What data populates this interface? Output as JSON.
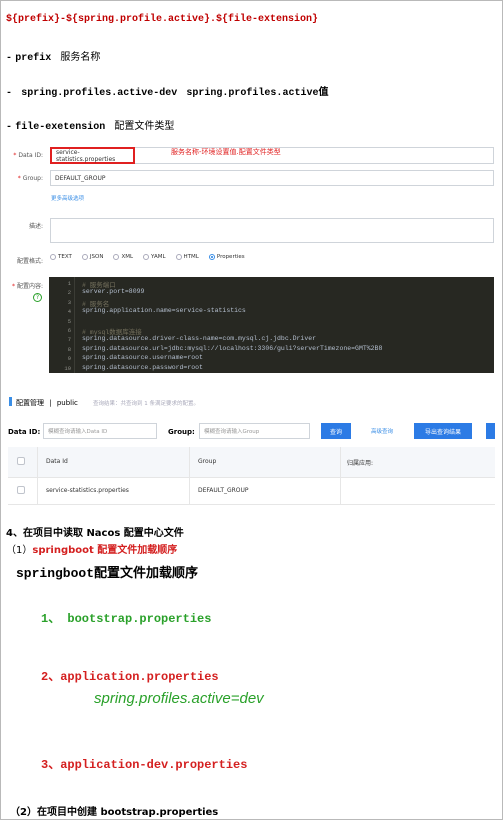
{
  "doc": {
    "heading": "${prefix}-${spring.profile.active}.${file-extension}",
    "bullets": [
      {
        "dash": "-",
        "key": "prefix",
        "desc": "服务名称"
      },
      {
        "dash": "-",
        "key": "spring.profiles.active-dev",
        "desc": "spring.profiles.active值"
      },
      {
        "dash": "-",
        "key": "file-exetension",
        "desc": "配置文件类型"
      }
    ]
  },
  "form": {
    "data_id_label": "Data ID:",
    "data_id_value": "service-statistics.properties",
    "annotation": "服务名称-环境设置值.配置文件类型",
    "group_label": "Group:",
    "group_value": "DEFAULT_GROUP",
    "advanced_link": "更多高级选项",
    "desc_label": "描述:",
    "format_label": "配置格式:",
    "formats": [
      "TEXT",
      "JSON",
      "XML",
      "YAML",
      "HTML",
      "Properties"
    ],
    "format_selected": "Properties",
    "content_label": "配置内容:",
    "help_icon": "?",
    "code_lines": [
      {
        "n": "1",
        "type": "comment",
        "text": "# 服务端口"
      },
      {
        "n": "2",
        "type": "key",
        "text": "server.port=8099"
      },
      {
        "n": "3",
        "type": "comment",
        "text": "# 服务名"
      },
      {
        "n": "4",
        "type": "key",
        "text": "spring.application.name=service-statistics"
      },
      {
        "n": "5",
        "type": "key",
        "text": ""
      },
      {
        "n": "6",
        "type": "comment",
        "text": "# mysql数据库连接"
      },
      {
        "n": "7",
        "type": "key",
        "text": "spring.datasource.driver-class-name=com.mysql.cj.jdbc.Driver"
      },
      {
        "n": "8",
        "type": "key",
        "text": "spring.datasource.url=jdbc:mysql://localhost:3306/guli?serverTimezone=GMT%2B8"
      },
      {
        "n": "9",
        "type": "key",
        "text": "spring.datasource.username=root"
      },
      {
        "n": "10",
        "type": "key",
        "text": "spring.datasource.password=root"
      }
    ]
  },
  "config_list": {
    "title": "配置管理",
    "separator": "|",
    "namespace": "public",
    "result_text": "查询结果：共查询到 1 条满足要求的配置。",
    "data_id_label": "Data ID:",
    "data_id_placeholder": "模糊查询请输入Data ID",
    "group_label": "Group:",
    "group_placeholder": "模糊查询请输入Group",
    "query_button": "查询",
    "advanced_query": "高级查询",
    "export_button": "导出查询结果",
    "columns": [
      "Data Id",
      "Group",
      "归属应用:"
    ],
    "rows": [
      {
        "data_id": "service-statistics.properties",
        "group": "DEFAULT_GROUP",
        "app": ""
      }
    ]
  },
  "section": {
    "heading": "4、在项目中读取 Nacos 配置中心文件",
    "sub1_prefix": "（1）",
    "sub1_text": "springboot 配置文件加载顺序",
    "order_title": "springboot配置文件加载顺序",
    "items": [
      {
        "text": "1、 bootstrap.properties",
        "color": "#2aa12a"
      },
      {
        "text": "2、application.properties",
        "color": "#d42020"
      },
      {
        "text": "spring.profiles.active=dev",
        "color": "#2aa12a"
      },
      {
        "text": "3、application-dev.properties",
        "color": "#d42020"
      }
    ],
    "sub2": "（2）在项目中创建 bootstrap.properties"
  },
  "colors": {
    "heading_red": "#c00000",
    "link_blue": "#3a8ee6",
    "primary_button": "#2c7be5",
    "editor_bg": "#272822"
  }
}
